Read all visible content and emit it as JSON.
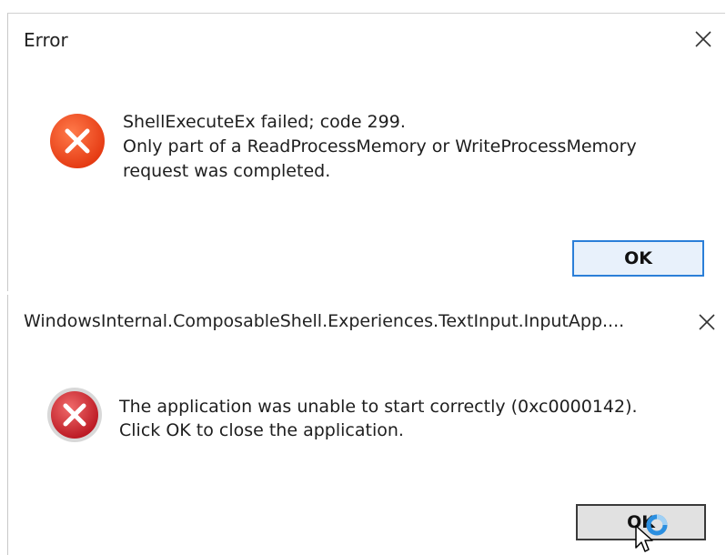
{
  "error_dialog": {
    "title": "Error",
    "icon": "error-x-icon",
    "message_lines": [
      "ShellExecuteEx failed; code 299.",
      "Only part of a ReadProcessMemory or WriteProcessMemory",
      "request was completed."
    ],
    "ok_label": "OK",
    "close_symbol": "✕",
    "icon_color": "#e8431e",
    "button_border_color": "#2b7fd8"
  },
  "app_dialog": {
    "title": "WindowsInternal.ComposableShell.Experiences.TextInput.InputApp....",
    "icon": "error-x-icon",
    "message_lines": [
      "The application was unable to start correctly (0xc0000142).",
      "Click OK to close the application."
    ],
    "ok_label": "OK",
    "close_symbol": "✕",
    "icon_color": "#c8232c",
    "busy_cursor": "busy-spinner-icon"
  }
}
